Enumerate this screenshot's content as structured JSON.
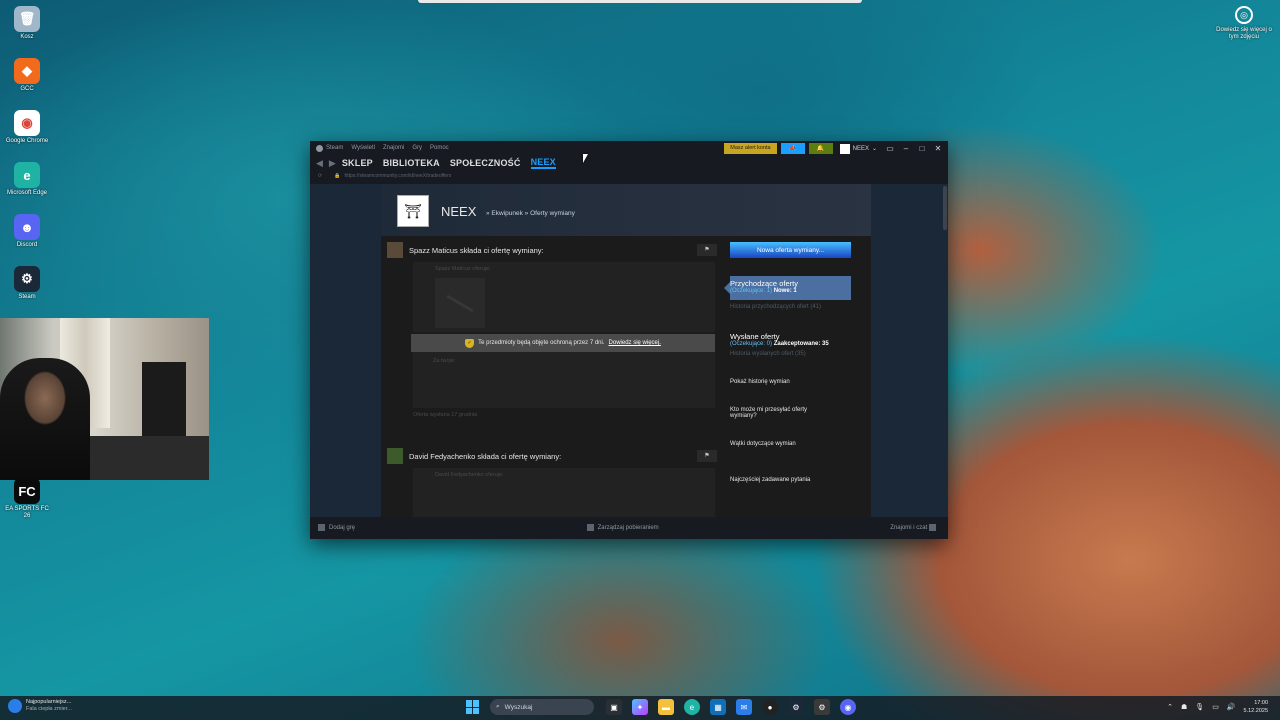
{
  "desktop": {
    "icons": [
      {
        "label": "Kosz",
        "icon": "recycle-bin-icon",
        "color": "#9fb7c9"
      },
      {
        "label": "GCC",
        "icon": "gcc-icon",
        "color": "#f26a1b"
      },
      {
        "label": "Google Chrome",
        "icon": "chrome-icon",
        "color": "#ffffff"
      },
      {
        "label": "Microsoft Edge",
        "icon": "edge-icon",
        "color": "#1fb3a3"
      },
      {
        "label": "Discord",
        "icon": "discord-icon",
        "color": "#5865f2"
      },
      {
        "label": "Steam",
        "icon": "steam-icon",
        "color": "#1b2838"
      },
      {
        "label": "EA SPORTS FC 26",
        "icon": "ea-fc-icon",
        "color": "#0b0b0b"
      }
    ],
    "info": {
      "label": "Dowiedz się więcej o tym zdjęciu"
    }
  },
  "steam": {
    "menu": [
      "Steam",
      "Wyświetl",
      "Znajomi",
      "Gry",
      "Pomoc"
    ],
    "alert_button": "Masz alert konta",
    "account_name": "NEEX",
    "nav": [
      "SKLEP",
      "BIBLIOTEKA",
      "SPOŁECZNOŚĆ",
      "NEEX"
    ],
    "url": "https://steamcommunity.com/id/neeX/tradeoffers",
    "profile": {
      "name": "NEEX",
      "breadcrumb": "» Ekwipunek » Oferty wymiany"
    },
    "offers": [
      {
        "title": "Spazz Maticus składa ci ofertę wymiany:",
        "items_label": "Spazz Maticus oferuje:",
        "notice": "Te przedmioty będą objęte ochroną przez 7 dni.",
        "notice_link": "Dowiedz się więcej.",
        "return_label": "Za twoje:",
        "footer": "Oferta wysłana 17 grudnia"
      },
      {
        "title": "David Fedyachenko składa ci ofertę wymiany:",
        "items_label": "David Fedyachenko oferuje:"
      }
    ],
    "sidebar": {
      "new_offer": "Nowa oferta wymiany...",
      "incoming": {
        "title": "Przychodzące oferty",
        "pending": "(Oczekujące: 1)",
        "new": "Nowe: 1",
        "history": "Historia przychodzących ofert (41)"
      },
      "sent": {
        "title": "Wysłane oferty",
        "pending": "(Oczekujące: 0)",
        "accepted": "Zaakceptowane: 35",
        "history": "Historia wysłanych ofert (35)"
      },
      "show_history": "Pokaż historię wymian",
      "who_can": "Kto może mi przesyłać oferty wymiany?",
      "issues": "Wątki dotyczące wymian",
      "faq": "Najczęściej zadawane pytania"
    },
    "footer": {
      "add_game": "Dodaj grę",
      "downloads": "Zarządzaj pobieraniem",
      "friends": "Znajomi i czat"
    }
  },
  "taskbar": {
    "news_title": "Najpopularniejsz...",
    "news_sub": "Fala ciepła zmier...",
    "search_placeholder": "Wyszukaj",
    "time": "17:00",
    "date": "5.12.2025"
  }
}
